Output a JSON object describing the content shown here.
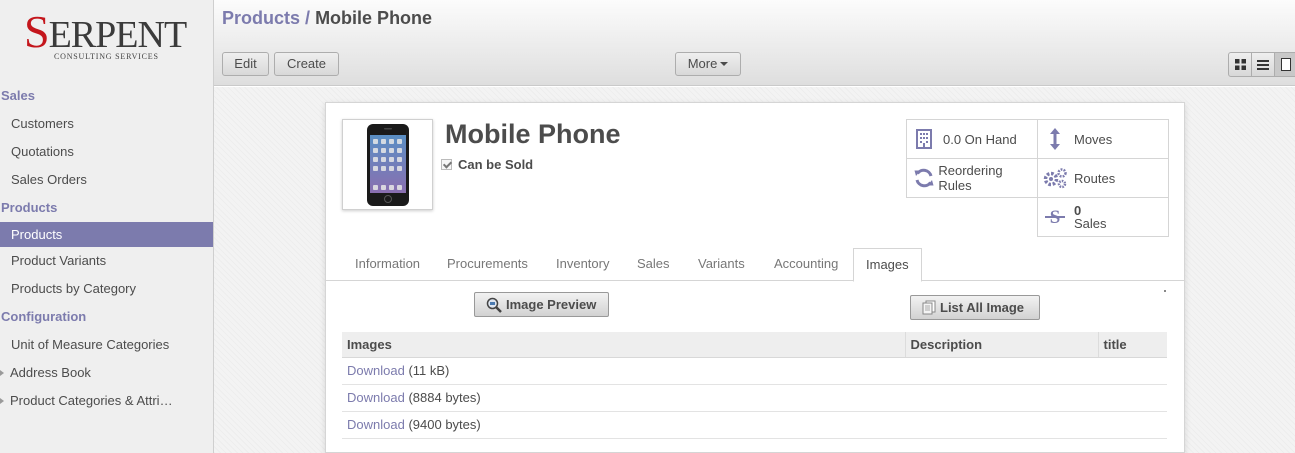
{
  "brand": {
    "logo_main": "ERPENT",
    "logo_initial": "S",
    "logo_sub": "CONSULTING SERVICES",
    "logo_color": "#c4161c"
  },
  "sidebar": {
    "sections": [
      {
        "label": "Sales",
        "items": [
          "Customers",
          "Quotations",
          "Sales Orders"
        ]
      },
      {
        "label": "Products",
        "items": [
          "Products",
          "Product Variants",
          "Products by Category"
        ]
      },
      {
        "label": "Configuration",
        "items": [
          "Unit of Measure Categories",
          "Address Book",
          "Product Categories & Attri…"
        ]
      }
    ],
    "active_item": "Products",
    "accent": "#7c7bad"
  },
  "header": {
    "breadcrumb_parent": "Products",
    "breadcrumb_sep": "/",
    "breadcrumb_current": "Mobile Phone",
    "edit_label": "Edit",
    "create_label": "Create",
    "more_label": "More"
  },
  "record": {
    "name": "Mobile Phone",
    "can_be_sold_label": "Can be Sold",
    "can_be_sold": true
  },
  "stat_buttons": {
    "on_hand": "0.0 On Hand",
    "moves": "Moves",
    "reordering": "Reordering Rules",
    "routes": "Routes",
    "sales_count": "0",
    "sales_label": "Sales"
  },
  "tabs": [
    "Information",
    "Procurements",
    "Inventory",
    "Sales",
    "Variants",
    "Accounting",
    "Images"
  ],
  "active_tab": "Images",
  "images_tab": {
    "image_preview_label": "Image Preview",
    "list_all_label": "List All Image",
    "columns": [
      "Images",
      "Description",
      "title"
    ],
    "rows": [
      {
        "link": "Download",
        "size": "(11 kB)",
        "description": "",
        "title": ""
      },
      {
        "link": "Download",
        "size": "(8884 bytes)",
        "description": "",
        "title": ""
      },
      {
        "link": "Download",
        "size": "(9400 bytes)",
        "description": "",
        "title": ""
      }
    ]
  }
}
